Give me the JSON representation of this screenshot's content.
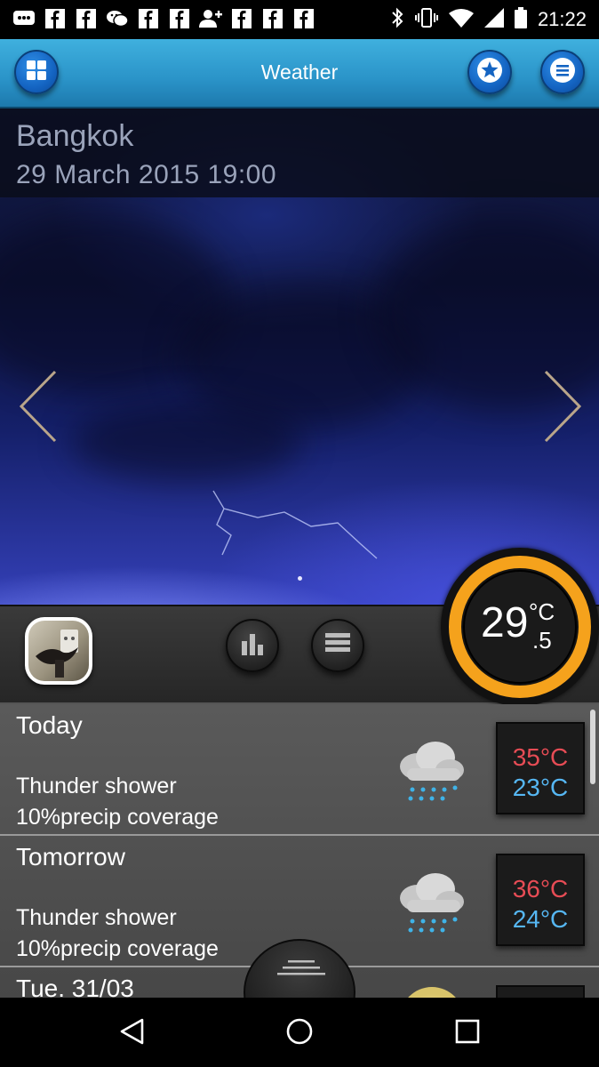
{
  "status_bar": {
    "time": "21:22",
    "left_icons": [
      "bbm-icon",
      "facebook-icon",
      "facebook-icon",
      "wechat-icon",
      "facebook-icon",
      "facebook-icon",
      "person-add-icon",
      "facebook-icon",
      "facebook-icon",
      "facebook-icon"
    ],
    "right_icons": [
      "bluetooth-icon",
      "vibrate-icon",
      "wifi-icon",
      "signal-icon",
      "battery-icon"
    ]
  },
  "app_bar": {
    "title": "Weather",
    "left_button_icon": "grid-icon",
    "right_buttons": [
      "star-icon",
      "menu-icon"
    ],
    "accent": "#2a93c8"
  },
  "location": {
    "city": "Bangkok",
    "datetime": "29  March  2015  19:00"
  },
  "current": {
    "temp_int": "29",
    "temp_dec": ".5",
    "unit": "°C",
    "ring_color": "#f5a21c"
  },
  "controls": [
    "photo-thumbnail",
    "chart-icon",
    "list-icon"
  ],
  "forecast": [
    {
      "day": "Today",
      "condition": "Thunder shower",
      "precip": "10%precip coverage",
      "high": "35°C",
      "low": "23°C",
      "icon": "thunder-shower-icon"
    },
    {
      "day": "Tomorrow",
      "condition": "Thunder shower",
      "precip": "10%precip coverage",
      "high": "36°C",
      "low": "24°C",
      "icon": "thunder-shower-icon"
    },
    {
      "day": "Tue.  31/03",
      "condition": "",
      "precip": "",
      "high": "",
      "low": "",
      "icon": "sun-icon"
    }
  ],
  "colors": {
    "high_temp": "#e74c55",
    "low_temp": "#56b7f3"
  },
  "nav_bar": [
    "back-icon",
    "home-icon",
    "recents-icon"
  ]
}
